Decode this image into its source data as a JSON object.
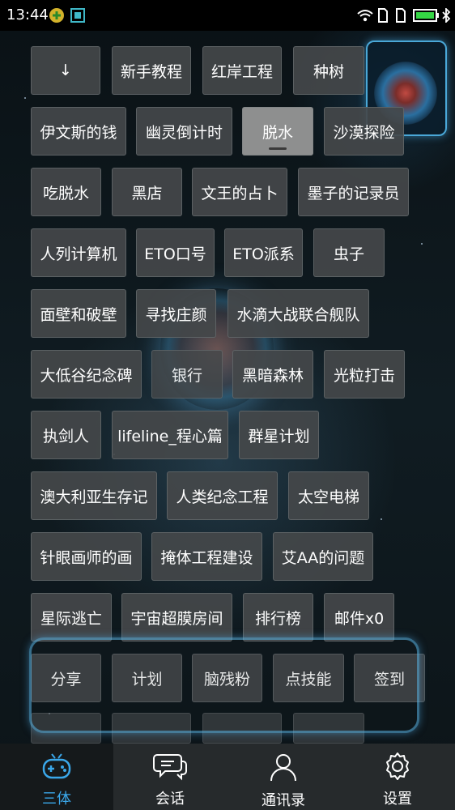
{
  "status_bar": {
    "time": "13:44",
    "icons": [
      "plus-badge-icon",
      "screenshot-icon",
      "wifi-icon",
      "sim1-icon",
      "sim2-icon",
      "battery-icon",
      "bluetooth-icon"
    ]
  },
  "buttons": [
    {
      "label": "↓"
    },
    {
      "label": "新手教程"
    },
    {
      "label": "红岸工程"
    },
    {
      "label": "种树"
    },
    {
      "label": "伊文斯的钱"
    },
    {
      "label": "幽灵倒计时"
    },
    {
      "label": "脱水",
      "selected": true
    },
    {
      "label": "沙漠探险"
    },
    {
      "label": "吃脱水"
    },
    {
      "label": "黑店"
    },
    {
      "label": "文王的占卜"
    },
    {
      "label": "墨子的记录员"
    },
    {
      "label": "人列计算机"
    },
    {
      "label": "ETO口号"
    },
    {
      "label": "ETO派系"
    },
    {
      "label": "虫子"
    },
    {
      "label": "面壁和破壁"
    },
    {
      "label": "寻找庄颜"
    },
    {
      "label": "水滴大战联合舰队"
    },
    {
      "label": "大低谷纪念碑"
    },
    {
      "label": "银行"
    },
    {
      "label": "黑暗森林"
    },
    {
      "label": "光粒打击"
    },
    {
      "label": "执剑人"
    },
    {
      "label": "lifeline_程心篇"
    },
    {
      "label": "群星计划"
    },
    {
      "label": "澳大利亚生存记"
    },
    {
      "label": "人类纪念工程"
    },
    {
      "label": "太空电梯"
    },
    {
      "label": "针眼画师的画"
    },
    {
      "label": "掩体工程建设"
    },
    {
      "label": "艾AA的问题"
    },
    {
      "label": "星际逃亡"
    },
    {
      "label": "宇宙超膜房间"
    },
    {
      "label": "排行榜"
    },
    {
      "label": "邮件x0"
    },
    {
      "label": "分享"
    },
    {
      "label": "计划"
    },
    {
      "label": "脑残粉"
    },
    {
      "label": "点技能"
    },
    {
      "label": "签到"
    }
  ],
  "tabs": [
    {
      "label": "三体",
      "icon": "gamepad-icon",
      "active": true
    },
    {
      "label": "会话",
      "icon": "chat-bubbles-icon"
    },
    {
      "label": "通讯录",
      "icon": "contacts-icon"
    },
    {
      "label": "设置",
      "icon": "gear-icon"
    }
  ],
  "colors": {
    "accent": "#3aa7ea",
    "button_bg": "#44484a",
    "tabbar_bg": "#262a2c"
  }
}
